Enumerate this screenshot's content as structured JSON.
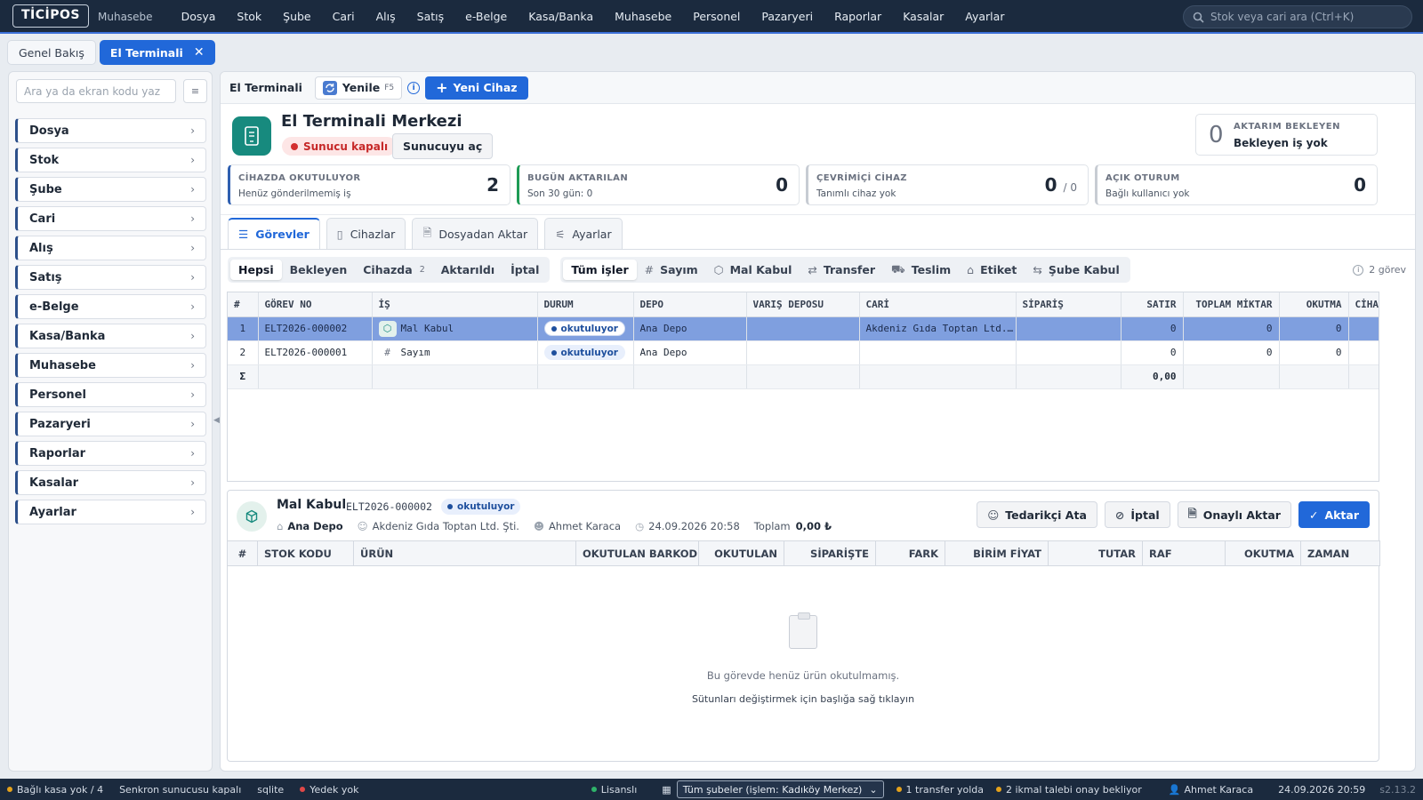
{
  "app": {
    "logo": "TİCİPOS",
    "product": "Muhasebe"
  },
  "top_menu": [
    "Dosya",
    "Stok",
    "Şube",
    "Cari",
    "Alış",
    "Satış",
    "e-Belge",
    "Kasa/Banka",
    "Muhasebe",
    "Personel",
    "Pazaryeri",
    "Raporlar",
    "Kasalar",
    "Ayarlar"
  ],
  "global_search": {
    "placeholder": "Stok veya cari ara (Ctrl+K)"
  },
  "page_tabs": {
    "overview": "Genel Bakış",
    "active": "El Terminali",
    "close": "✕"
  },
  "sidebar": {
    "search_placeholder": "Ara ya da ekran kodu yaz",
    "items": [
      "Dosya",
      "Stok",
      "Şube",
      "Cari",
      "Alış",
      "Satış",
      "e-Belge",
      "Kasa/Banka",
      "Muhasebe",
      "Personel",
      "Pazaryeri",
      "Raporlar",
      "Kasalar",
      "Ayarlar"
    ]
  },
  "toolbar": {
    "title": "El Terminali",
    "refresh": "Yenile",
    "refresh_key": "F5",
    "new_device": "Yeni Cihaz"
  },
  "header": {
    "title": "El Terminali Merkezi",
    "server_status": "Sunucu kapalı",
    "open_server": "Sunucuyu aç",
    "pending": {
      "value": "0",
      "label": "AKTARIM BEKLEYEN",
      "text": "Bekleyen iş yok"
    }
  },
  "kpis": [
    {
      "label": "CİHAZDA OKUTULUYOR",
      "sub": "Henüz gönderilmemiş iş",
      "value": "2",
      "extra": "",
      "accent": "#2f5fb0"
    },
    {
      "label": "BUGÜN AKTARILAN",
      "sub": "Son 30 gün: 0",
      "value": "0",
      "extra": "",
      "accent": "#1e9b55"
    },
    {
      "label": "ÇEVRİMİÇİ CİHAZ",
      "sub": "Tanımlı cihaz yok",
      "value": "0",
      "extra": "/ 0",
      "accent": "#c7ccd3"
    },
    {
      "label": "AÇIK OTURUM",
      "sub": "Bağlı kullanıcı yok",
      "value": "0",
      "extra": "",
      "accent": "#c7ccd3"
    }
  ],
  "section_tabs": [
    "Görevler",
    "Cihazlar",
    "Dosyadan Aktar",
    "Ayarlar"
  ],
  "status_filters": [
    {
      "label": "Hepsi",
      "count": ""
    },
    {
      "label": "Bekleyen",
      "count": ""
    },
    {
      "label": "Cihazda",
      "count": "2"
    },
    {
      "label": "Aktarıldı",
      "count": ""
    },
    {
      "label": "İptal",
      "count": ""
    }
  ],
  "type_filters": [
    "Tüm işler",
    "Sayım",
    "Mal Kabul",
    "Transfer",
    "Teslim",
    "Etiket",
    "Şube Kabul"
  ],
  "task_count": "2 görev",
  "grid": {
    "columns": [
      "#",
      "GÖREV NO",
      "İŞ",
      "DURUM",
      "DEPO",
      "VARIŞ DEPOSU",
      "CARİ",
      "SİPARİŞ",
      "SATIR",
      "TOPLAM MİKTAR",
      "OKUTMA",
      "CİHAZ"
    ],
    "rows": [
      {
        "n": "1",
        "no": "ELT2026-000002",
        "is": "Mal Kabul",
        "durum": "okutuluyor",
        "depo": "Ana Depo",
        "varis": "",
        "cari": "Akdeniz Gıda Toptan Ltd. Şti.",
        "siparis": "",
        "satir": "0",
        "toplam": "0",
        "okutma": "0",
        "cihaz": ""
      },
      {
        "n": "2",
        "no": "ELT2026-000001",
        "is": "Sayım",
        "durum": "okutuluyor",
        "depo": "Ana Depo",
        "varis": "",
        "cari": "",
        "siparis": "",
        "satir": "0",
        "toplam": "0",
        "okutma": "0",
        "cihaz": ""
      }
    ],
    "sum_symbol": "Σ",
    "sum_satir": "0,00"
  },
  "detail": {
    "title": "Mal Kabul",
    "no": "ELT2026-000002",
    "status": "okutuluyor",
    "depot": "Ana Depo",
    "supplier": "Akdeniz Gıda Toptan Ltd. Şti.",
    "user": "Ahmet Karaca",
    "datetime": "24.09.2026 20:58",
    "total_label": "Toplam",
    "total_value": "0,00 ₺",
    "actions": {
      "assign": "Tedarikçi Ata",
      "cancel": "İptal",
      "approved": "Onaylı Aktar",
      "transfer": "Aktar"
    },
    "columns": [
      "#",
      "STOK KODU",
      "ÜRÜN",
      "OKUTULAN BARKOD",
      "OKUTULAN",
      "SİPARİŞTE",
      "FARK",
      "BİRİM FİYAT",
      "TUTAR",
      "RAF",
      "OKUTMA",
      "ZAMAN"
    ],
    "empty_text": "Bu görevde henüz ürün okutulmamış.",
    "empty_hint": "Sütunları değiştirmek için başlığa sağ tıklayın"
  },
  "statusbar": {
    "cash": "Bağlı kasa yok / 4",
    "sync": "Senkron sunucusu kapalı",
    "db": "sqlite",
    "backup": "Yedek yok",
    "license": "Lisanslı",
    "branch": "Tüm şubeler (işlem: Kadıköy Merkez)",
    "transfers": "1 transfer yolda",
    "requests": "2 ikmal talebi onay bekliyor",
    "user": "Ahmet Karaca",
    "datetime": "24.09.2026 20:59",
    "version": "s2.13.2"
  }
}
